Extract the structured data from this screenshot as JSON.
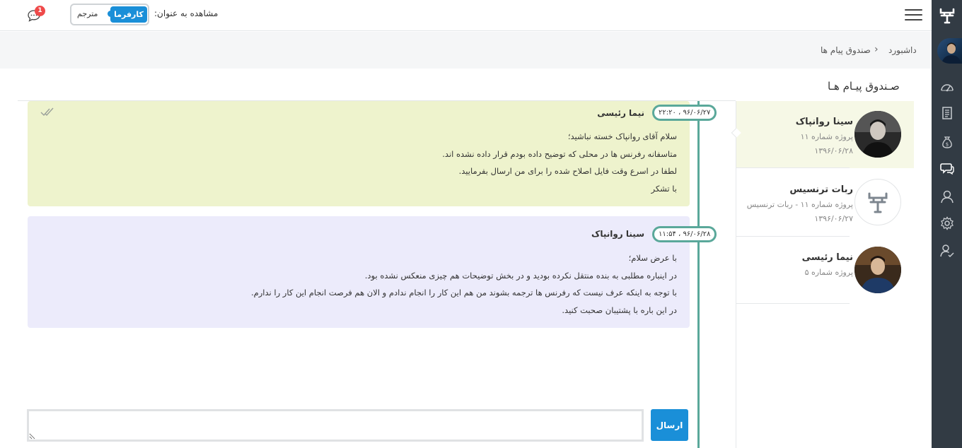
{
  "topbar": {
    "view_as_label": "مشاهده به عنوان:",
    "role_toggle": {
      "options": [
        "کارفرما",
        "مترجم"
      ],
      "selected": "کارفرما"
    },
    "notification_count": "1"
  },
  "breadcrumb": {
    "home": "داشبورد",
    "separator": "›",
    "current": "صندوق پیام ها"
  },
  "page_title": "صـندوق پیـام هـا",
  "conversations": [
    {
      "name": "سینا روانپاک",
      "project": "پروژه شماره ۱۱",
      "date": "۱۳۹۶/۰۶/۲۸",
      "active": true
    },
    {
      "name": "ربات ترنسیس",
      "project": "پروژه شماره ۱۱ - ربات ترنسیس",
      "date": "۱۳۹۶/۰۶/۲۷",
      "active": false
    },
    {
      "name": "نیما رئیسی",
      "project": "پروژه شماره ۵",
      "date": "",
      "active": false
    }
  ],
  "messages": [
    {
      "sender": "نیما رئیسی",
      "timestamp": "۲۲:۲۰ ، ۹۶/۰۶/۲۷",
      "lines": [
        "سلام آقای روانپاک خسته نباشید؛",
        "متاسفانه رفرنس ها در محلی که توضیح داده بودم قرار داده نشده اند.",
        "لطفا در اسرع وقت فایل اصلاح شده را برای من ارسال بفرمایید.",
        "با تشکر"
      ],
      "read": true
    },
    {
      "sender": "سینا روانپاک",
      "timestamp": "۱۱:۵۴ ، ۹۶/۰۶/۲۸",
      "lines": [
        "با عرض سلام؛",
        "در اینباره مطلبی به بنده منتقل نکرده بودید و در بخش توضیحات هم چیزی منعکس نشده بود.",
        "با توجه به اینکه عرف نیست که رفرنس ها ترجمه بشوند من هم این کار را انجام ندادم و الان هم فرصت انجام این کار را ندارم.",
        "در این باره با پشتیبان صحبت کنید."
      ],
      "read": false
    }
  ],
  "composer": {
    "placeholder": "",
    "value": "",
    "send_label": "ارسال"
  },
  "sidebar_icons": [
    "app-logo",
    "user-avatar",
    "dashboard-gauge-icon",
    "documents-icon",
    "money-bag-icon",
    "messages-icon",
    "profile-icon",
    "settings-gear-icon",
    "user-check-icon"
  ],
  "colors": {
    "accent": "#1a8fd8",
    "timeline": "#5aa89a",
    "sidebar": "#323b44",
    "msg_incoming": "#eef3cd",
    "msg_outgoing": "#ecebfb",
    "badge": "#ef4a4a"
  }
}
